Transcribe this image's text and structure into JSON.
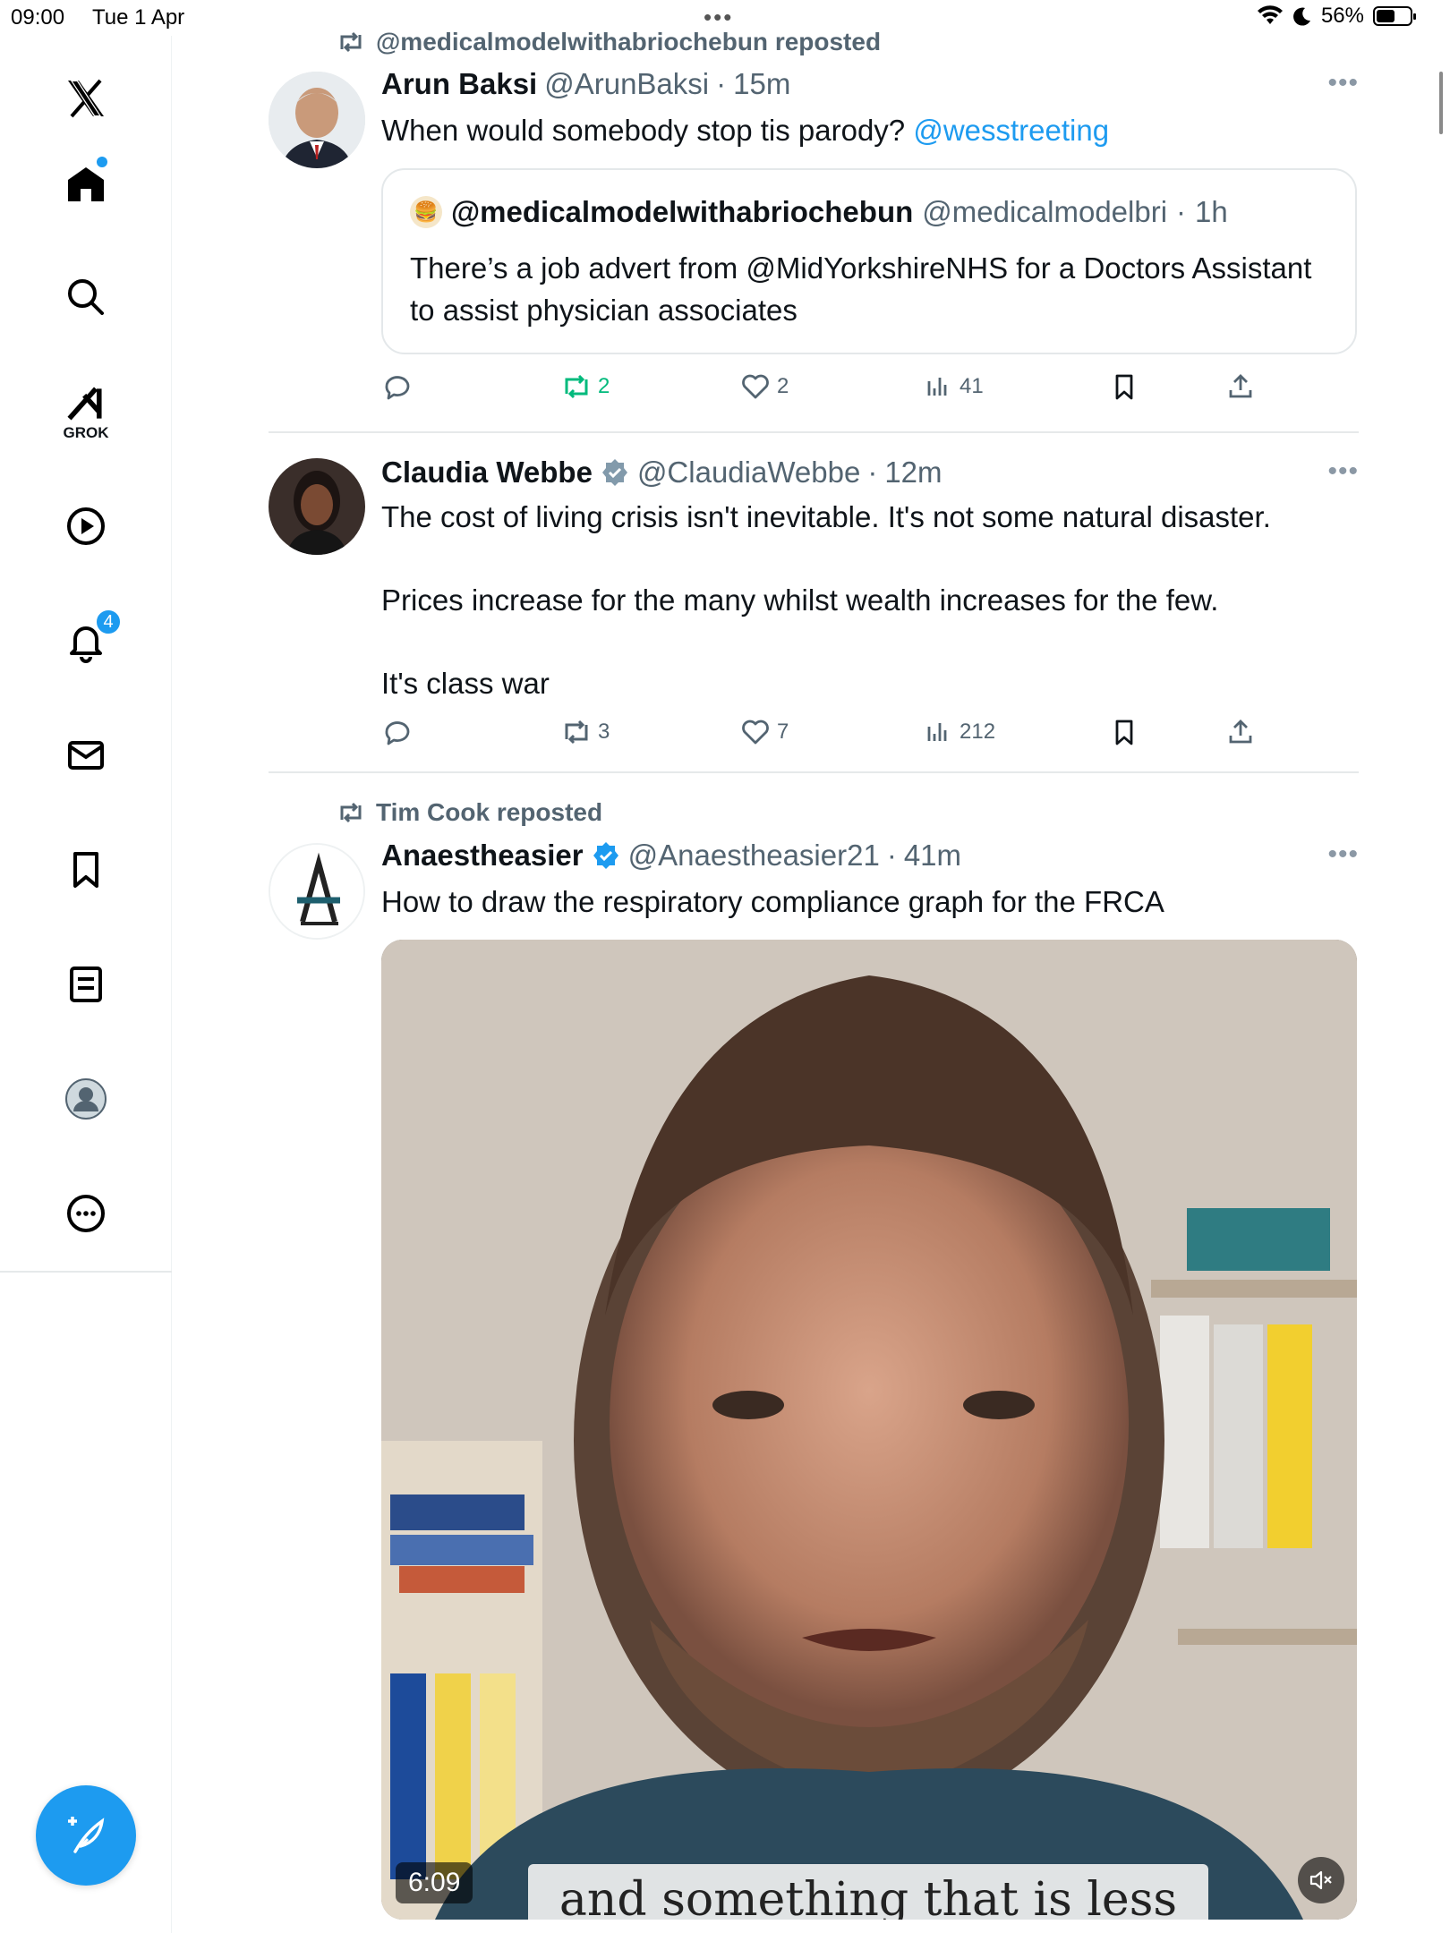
{
  "status_bar": {
    "time": "09:00",
    "date": "Tue 1 Apr",
    "battery_percent": "56%",
    "battery_level": 0.56
  },
  "sidebar": {
    "items": [
      {
        "name": "home",
        "icon": "home-icon",
        "active": true
      },
      {
        "name": "search",
        "icon": "search-icon"
      },
      {
        "name": "grok",
        "icon": "grok-icon",
        "label": "GROK"
      },
      {
        "name": "video",
        "icon": "play-icon"
      },
      {
        "name": "notifications",
        "icon": "bell-icon",
        "badge": "4"
      },
      {
        "name": "messages",
        "icon": "mail-icon"
      },
      {
        "name": "bookmarks",
        "icon": "bookmark-icon"
      },
      {
        "name": "lists",
        "icon": "list-icon"
      },
      {
        "name": "profile",
        "icon": "avatar-icon"
      },
      {
        "name": "more",
        "icon": "more-circle-icon"
      }
    ],
    "compose_icon": "compose-icon"
  },
  "colors": {
    "accent": "#1d9bf0",
    "repost_green": "#00ba7c",
    "muted": "#536471"
  },
  "feed": {
    "tweets": [
      {
        "repost_by": "@medicalmodelwithabriochebun reposted",
        "name": "Arun Baksi",
        "handle": "@ArunBaksi",
        "dot": "·",
        "time": "15m",
        "text_before": "When would somebody stop tis parody? ",
        "mention": "@wesstreeting",
        "quote": {
          "name": "@medicalmodelwithabriochebun",
          "handle": "@medicalmodelbri",
          "dot": "·",
          "time": "1h",
          "text": "There’s a job advert from @MidYorkshireNHS for a Doctors Assistant to assist physician associates"
        },
        "replies": "",
        "reposts": "2",
        "likes": "2",
        "views": "41"
      },
      {
        "name": "Claudia Webbe",
        "handle": "@ClaudiaWebbe",
        "dot": "·",
        "time": "12m",
        "text_lines": [
          "The cost of living crisis isn't inevitable. It's not some natural disaster.",
          "",
          "Prices increase for the many whilst wealth increases for the few.",
          "",
          "It's class war"
        ],
        "replies": "",
        "reposts": "3",
        "likes": "7",
        "views": "212"
      },
      {
        "repost_by": "Tim Cook reposted",
        "name": "Anaestheasier",
        "handle": "@Anaestheasier21",
        "dot": "·",
        "time": "41m",
        "text": "How to draw the respiratory compliance graph for the FRCA",
        "video": {
          "duration": "6:09",
          "caption": "and something that is less"
        }
      }
    ]
  }
}
